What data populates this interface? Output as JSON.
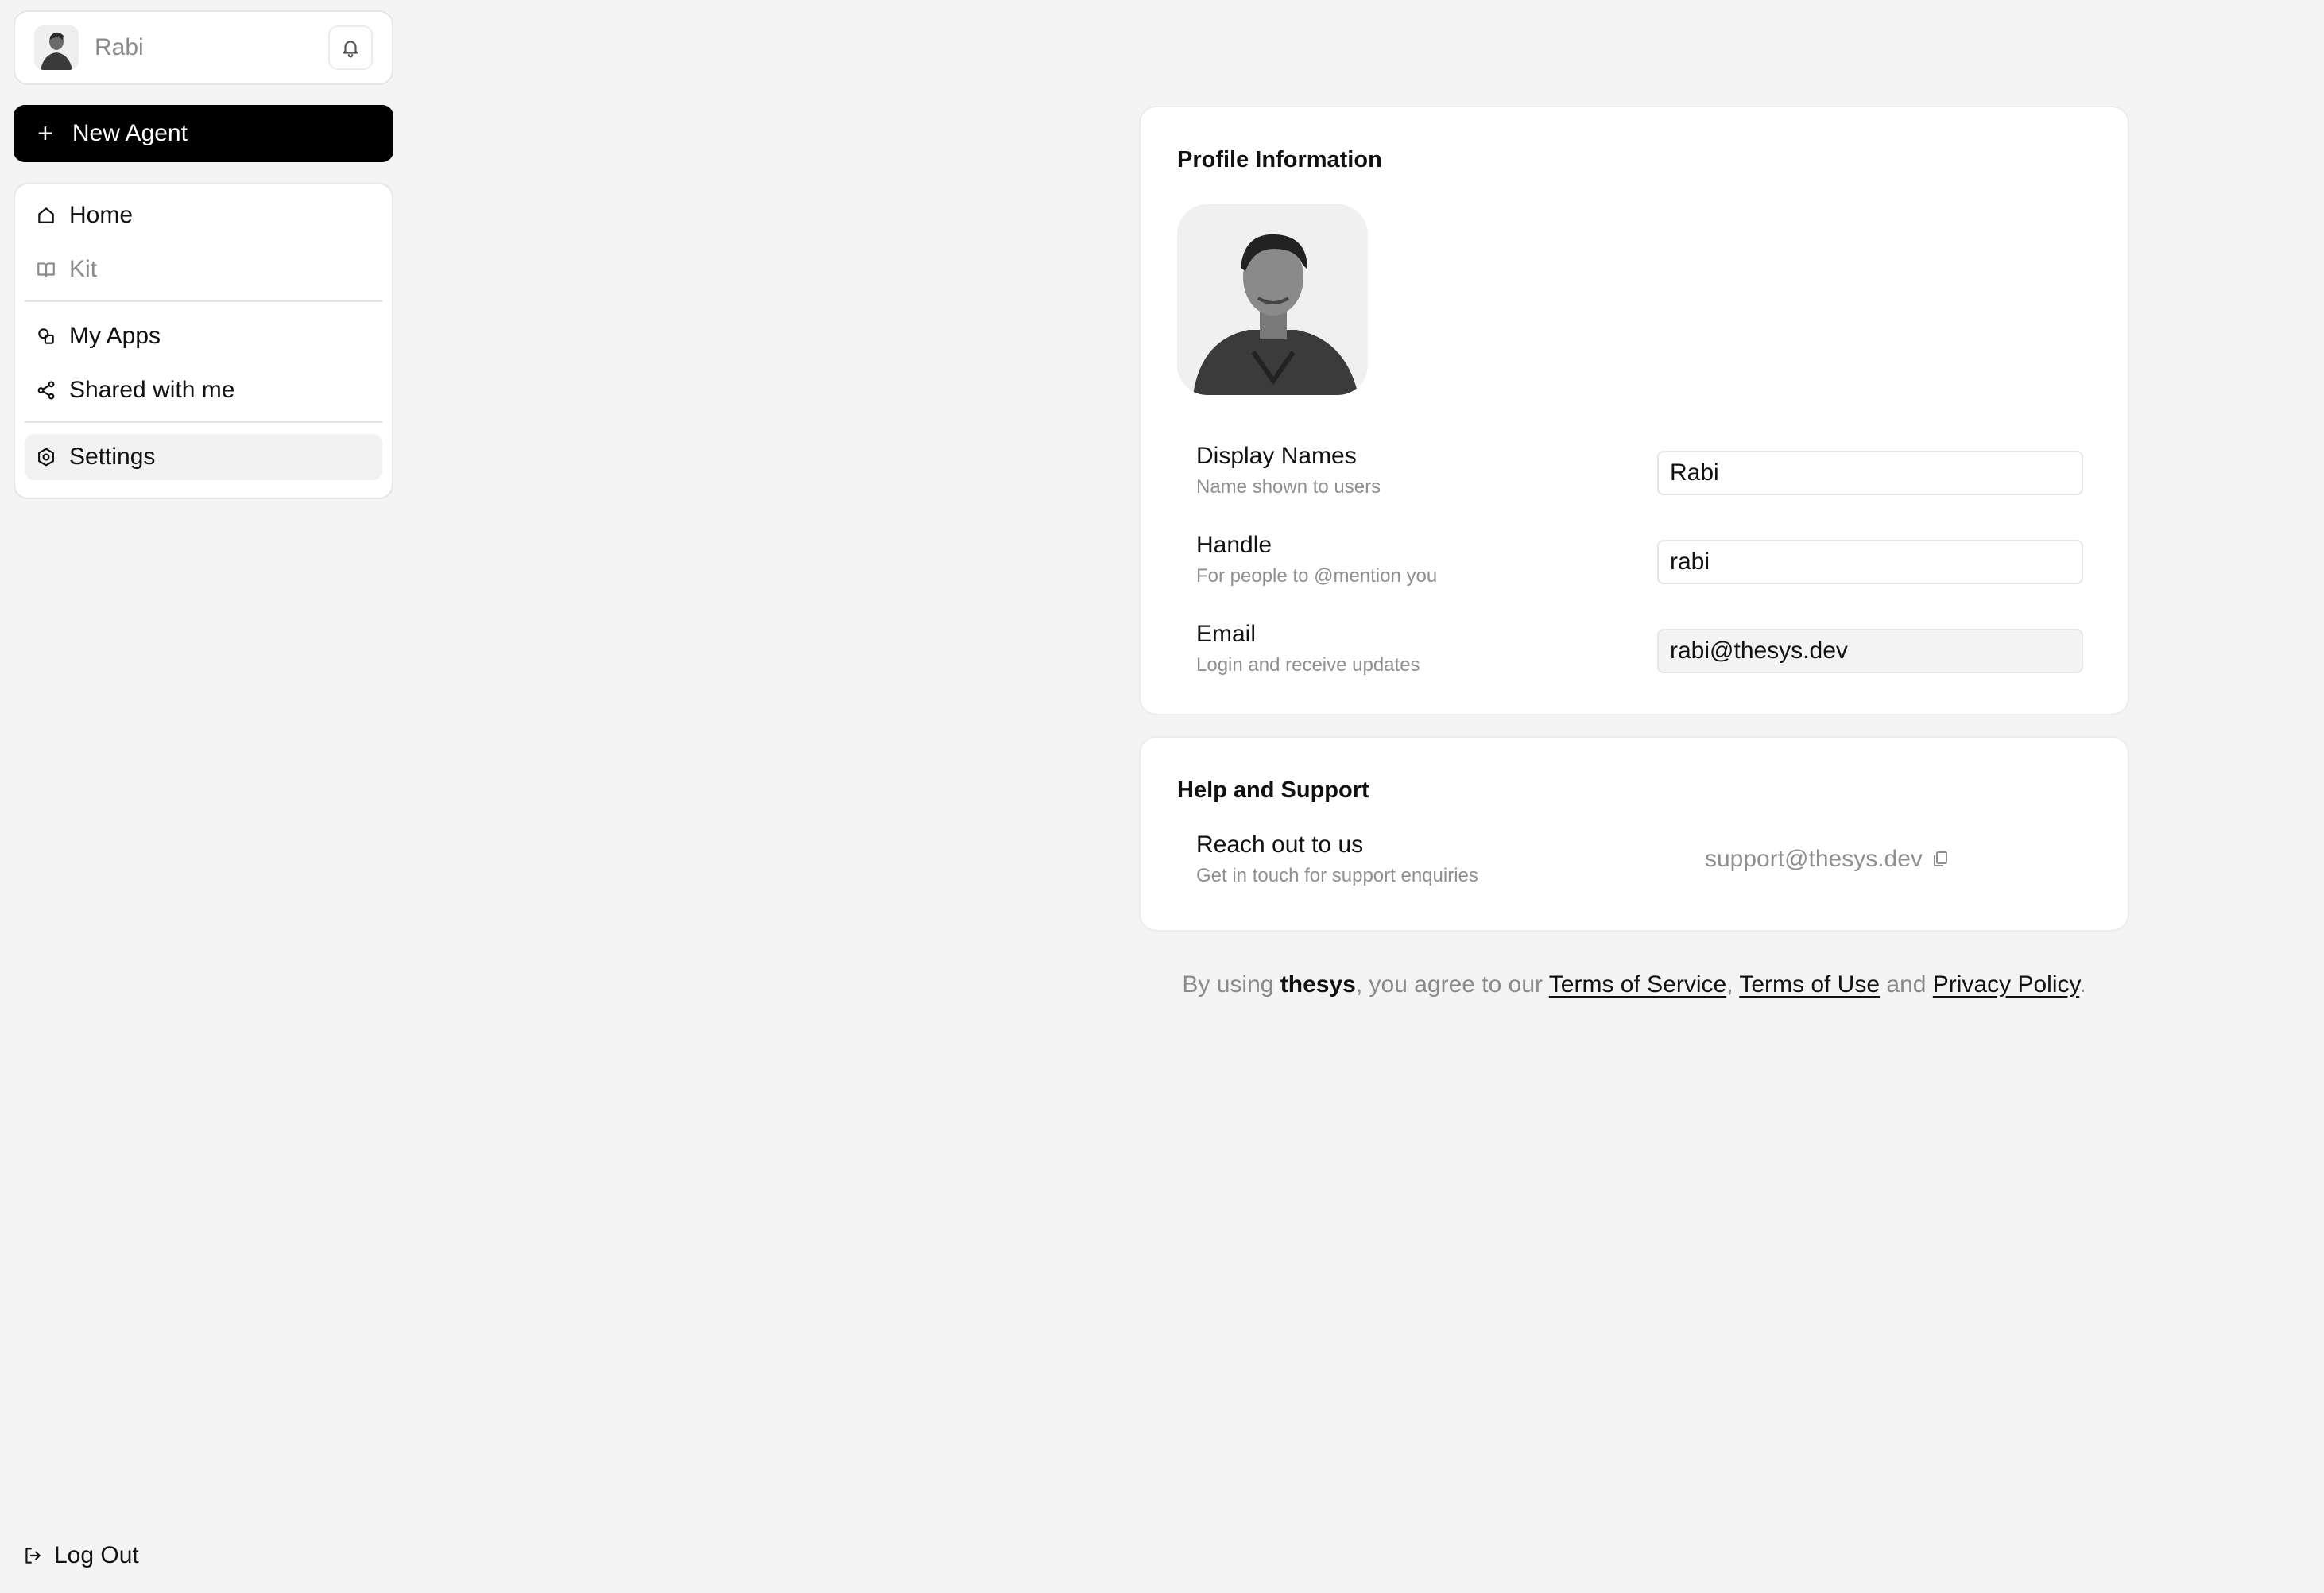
{
  "sidebar": {
    "user": {
      "name": "Rabi"
    },
    "new_agent_label": "New Agent",
    "nav": [
      {
        "label": "Home"
      },
      {
        "label": "Kit"
      },
      {
        "label": "My Apps"
      },
      {
        "label": "Shared with me"
      },
      {
        "label": "Settings"
      }
    ],
    "logout_label": "Log Out"
  },
  "profile": {
    "title": "Profile Information",
    "fields": [
      {
        "label": "Display Names",
        "sub": "Name shown to users",
        "value": "Rabi"
      },
      {
        "label": "Handle",
        "sub": "For people to @mention you",
        "value": "rabi"
      },
      {
        "label": "Email",
        "sub": "Login and receive updates",
        "value": "rabi@thesys.dev"
      }
    ]
  },
  "help": {
    "title": "Help and Support",
    "label": "Reach out to us",
    "sub": "Get in touch for support enquiries",
    "email": "support@thesys.dev"
  },
  "footer": {
    "prefix": "By using ",
    "brand": "thesys",
    "middle": ", you agree to our ",
    "terms_service": "Terms of Service",
    "comma": ", ",
    "terms_use": "Terms of Use",
    "and": " and ",
    "privacy": "Privacy Policy",
    "period": "."
  },
  "colors": {
    "primary": "#000000",
    "background": "#f4f4f4",
    "muted": "#8a8a8a"
  }
}
